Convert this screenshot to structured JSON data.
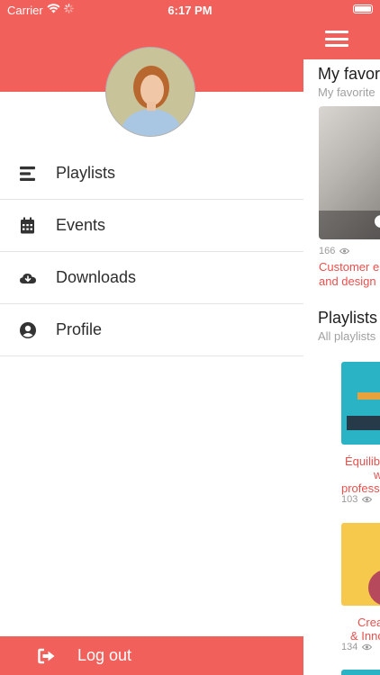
{
  "status_bar": {
    "carrier": "Carrier",
    "time": "6:17 PM"
  },
  "colors": {
    "accent": "#f2605b",
    "accent_text": "#e9504d"
  },
  "drawer": {
    "menu": [
      {
        "label": "Playlists",
        "icon": "list-icon"
      },
      {
        "label": "Events",
        "icon": "calendar-icon"
      },
      {
        "label": "Downloads",
        "icon": "cloud-download-icon"
      },
      {
        "label": "Profile",
        "icon": "user-circle-icon"
      }
    ],
    "logout_label": "Log out"
  },
  "main": {
    "favorites": {
      "title": "My favor",
      "subtitle": "My favorite",
      "item": {
        "views": "166",
        "title_line1": "Customer e",
        "title_line2": "and design"
      }
    },
    "playlists": {
      "title": "Playlists",
      "subtitle": "All playlists",
      "items": [
        {
          "line1": "Équilib",
          "line2": "w",
          "line3": "profess",
          "views": "103"
        },
        {
          "line1": "Crea",
          "line2": "& Inno",
          "views": "134"
        }
      ]
    }
  }
}
